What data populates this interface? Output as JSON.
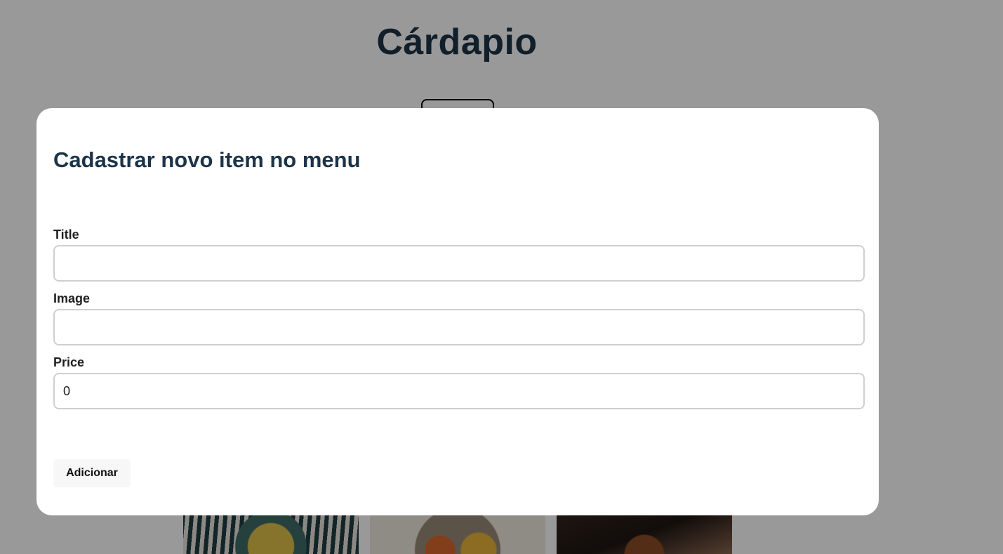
{
  "page": {
    "title": "Cárdapio"
  },
  "modal": {
    "title": "Cadastrar novo item no menu",
    "fields": [
      {
        "label": "Title",
        "value": "",
        "placeholder": ""
      },
      {
        "label": "Image",
        "value": "",
        "placeholder": ""
      },
      {
        "label": "Price",
        "value": "0",
        "placeholder": ""
      }
    ],
    "submit_label": "Adicionar"
  },
  "colors": {
    "heading": "#1d3448",
    "overlay": "rgba(0,0,0,0.4)",
    "input_border": "#cfcfcf",
    "button_bg": "#f7f7f7"
  }
}
